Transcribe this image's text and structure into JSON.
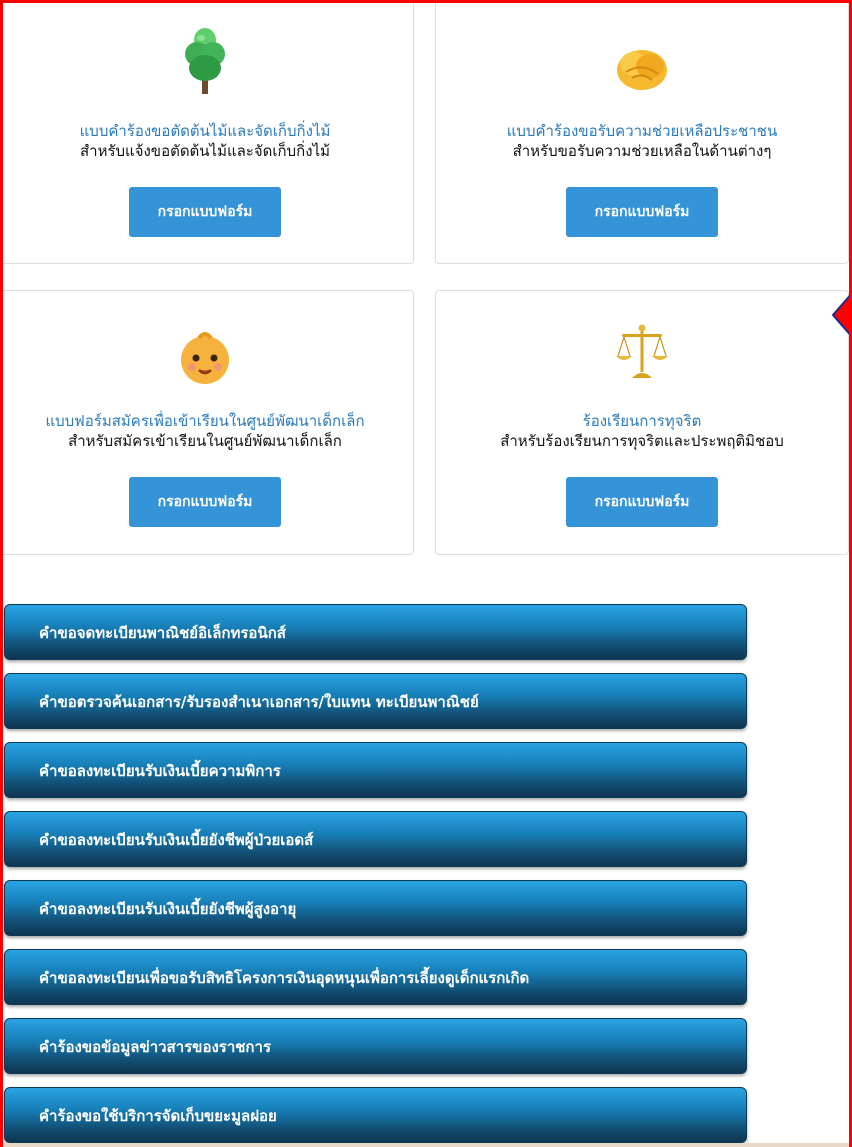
{
  "cards": [
    {
      "title": "แบบคำร้องขอตัดต้นไม้และจัดเก็บกิ่งไม้",
      "desc": "สำหรับแจ้งขอตัดต้นไม้และจัดเก็บกิ่งไม้",
      "button": "กรอกแบบฟอร์ม",
      "icon": "tree-icon"
    },
    {
      "title": "แบบคำร้องขอรับความช่วยเหลือประชาชน",
      "desc": "สำหรับขอรับความช่วยเหลือในด้านต่างๆ",
      "button": "กรอกแบบฟอร์ม",
      "icon": "handshake-icon"
    },
    {
      "title": "แบบฟอร์มสมัครเพื่อเข้าเรียนในศูนย์พัฒนาเด็กเล็ก",
      "desc": "สำหรับสมัครเข้าเรียนในศูนย์พัฒนาเด็กเล็ก",
      "button": "กรอกแบบฟอร์ม",
      "icon": "baby-icon"
    },
    {
      "title": "ร้องเรียนการทุจริต",
      "desc": "สำหรับร้องเรียนการทุจริตและประพฤติมิชอบ",
      "button": "กรอกแบบฟอร์ม",
      "icon": "scales-icon"
    }
  ],
  "services": [
    "คำขอจดทะเบียนพาณิชย์อิเล็กทรอนิกส์",
    "คำขอตรวจค้นเอกสาร/รับรองสำเนาเอกสาร/ใบแทน ทะเบียนพาณิชย์",
    "คำขอลงทะเบียนรับเงินเบี้ยความพิการ",
    "คำขอลงทะเบียนรับเงินเบี้ยยังชีพผู้ป่วยเอดส์",
    "คำขอลงทะเบียนรับเงินเบี้ยยังชีพผู้สูงอายุ",
    "คำขอลงทะเบียนเพื่อขอรับสิทธิโครงการเงินอุดหนุนเพื่อการเลี้ยงดูเด็กแรกเกิด",
    "คำร้องขอข้อมูลข่าวสารของราชการ",
    "คำร้องขอใช้บริการจัดเก็บขยะมูลฝอย"
  ],
  "colors": {
    "highlight_frame": "#ff0000",
    "card_title": "#2a7bbd",
    "form_button": "#3593d7",
    "service_bar_top": "#2aa3e3",
    "service_bar_bottom": "#0f3550"
  }
}
